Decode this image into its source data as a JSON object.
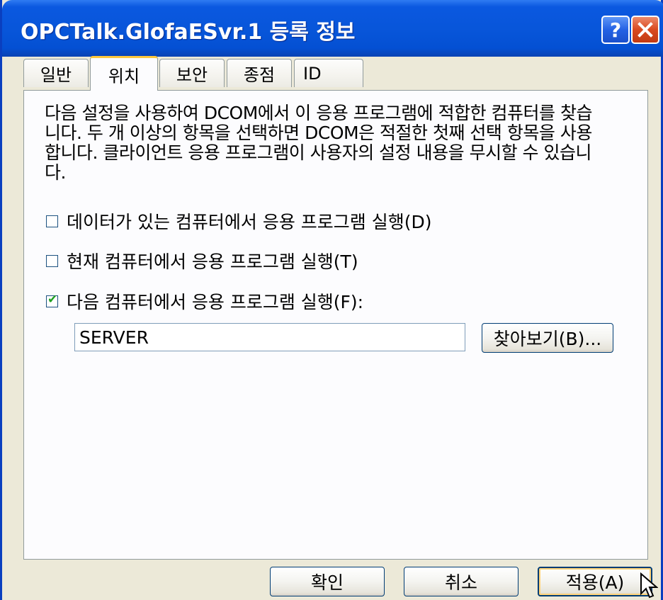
{
  "window": {
    "title": "OPCTalk.GlofaESvr.1 등록 정보",
    "help_glyph": "?"
  },
  "tabs": [
    {
      "label": "일반",
      "active": false
    },
    {
      "label": "위치",
      "active": true
    },
    {
      "label": "보안",
      "active": false
    },
    {
      "label": "종점",
      "active": false
    },
    {
      "label": "ID",
      "active": false
    }
  ],
  "location": {
    "description_lines": [
      "다음 설정을 사용하여 DCOM에서 이 응용 프로그램에 적합한 컴퓨터를 찾습",
      "니다. 두 개 이상의 항목을 선택하면 DCOM은 적절한 첫째 선택 항목을 사용",
      "합니다. 클라이언트 응용 프로그램이 사용자의 설정 내용을 무시할 수 있습니",
      "다."
    ],
    "options": [
      {
        "label": "데이터가 있는 컴퓨터에서 응용 프로그램 실행(D)",
        "checked": false
      },
      {
        "label": "현재 컴퓨터에서 응용 프로그램 실행(T)",
        "checked": false
      },
      {
        "label": "다음 컴퓨터에서 응용 프로그램 실행(F):",
        "checked": true
      }
    ],
    "computer_name_value": "SERVER",
    "browse_label": "찾아보기(B)..."
  },
  "footer": {
    "ok_label": "확인",
    "cancel_label": "취소",
    "apply_label": "적용(A)"
  },
  "colors": {
    "titlebar": "#0856da",
    "dialog_bg": "#ece9d8",
    "active_tab_highlight": "#ffc83c",
    "close_button": "#d9491f",
    "checkmark": "#21a121"
  }
}
